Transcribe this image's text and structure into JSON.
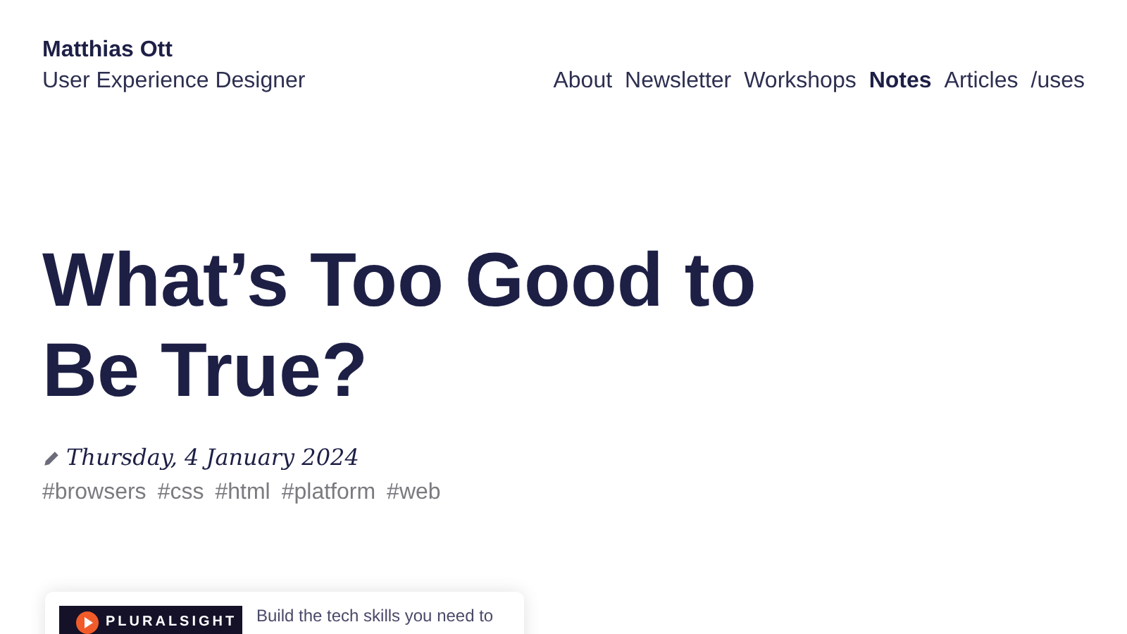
{
  "site": {
    "name": "Matthias Ott",
    "tagline": "User Experience Designer"
  },
  "nav": [
    {
      "label": "About",
      "selected": false
    },
    {
      "label": "Newsletter",
      "selected": false
    },
    {
      "label": "Workshops",
      "selected": false
    },
    {
      "label": "Notes",
      "selected": true
    },
    {
      "label": "Articles",
      "selected": false
    },
    {
      "label": "/uses",
      "selected": false
    }
  ],
  "article": {
    "title": "What’s Too Good to Be True?",
    "date": "Thursday, 4 January 2024",
    "tags": [
      "#browsers",
      "#css",
      "#html",
      "#platform",
      "#web"
    ]
  },
  "ad": {
    "brand": "PLURALSIGHT",
    "text": "Build the tech skills you need to"
  }
}
